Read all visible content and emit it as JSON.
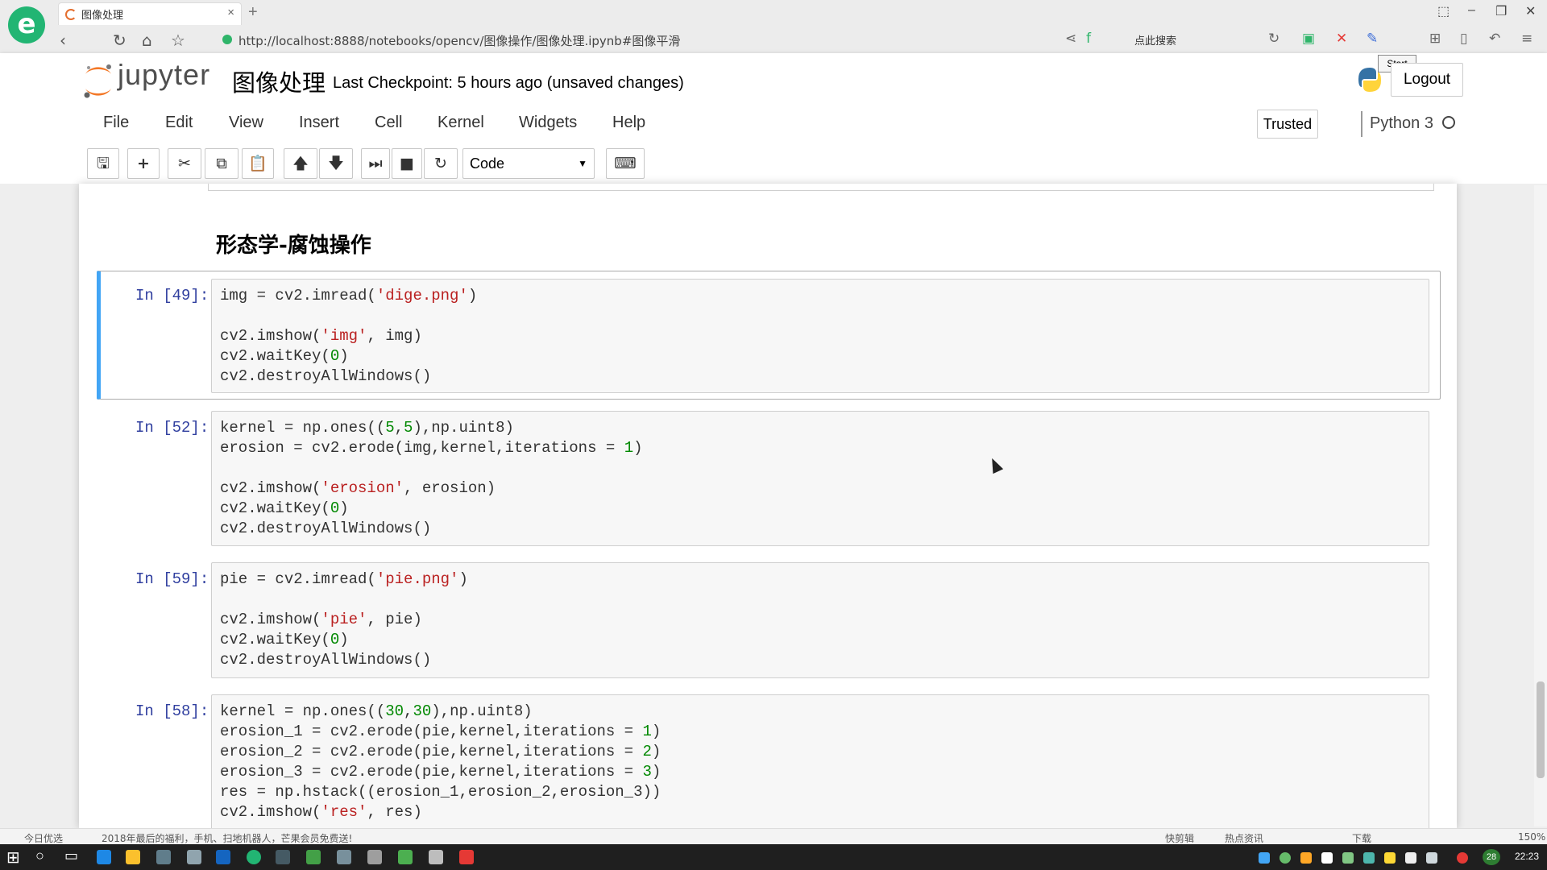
{
  "browser": {
    "tab_title": "图像处理",
    "new_tab": "+",
    "address": "http://localhost:8888/notebooks/opencv/图像操作/图像处理.ipynb#图像平滑",
    "search_placeholder": "点此搜索",
    "tooltip": "Start",
    "win_min": "–",
    "win_max": "❐",
    "win_close": "✕"
  },
  "notebook": {
    "logo_text": "jupyter",
    "name": "图像处理",
    "checkpoint": "Last Checkpoint: 5 hours ago (unsaved changes)",
    "logout_label": "Logout",
    "trusted_label": "Trusted",
    "kernel_name": "Python 3"
  },
  "menu": {
    "items": [
      "File",
      "Edit",
      "View",
      "Insert",
      "Cell",
      "Kernel",
      "Widgets",
      "Help"
    ]
  },
  "toolbar": {
    "cell_type": "Code"
  },
  "cells": {
    "heading": "形态学-腐蚀操作",
    "prompts": [
      "In [49]:",
      "In [52]:",
      "In [59]:",
      "In [58]:"
    ]
  },
  "statusbar": {
    "left_label": "今日优选",
    "news": "2018年最后的福利，手机、扫地机器人，芒果会员免费送!",
    "items": [
      "快剪辑",
      "热点资讯",
      "下载"
    ],
    "zoom": "150%"
  },
  "taskbar": {
    "time": "22:23",
    "badge": "28"
  },
  "colors": {
    "selected_cell_border": "#42a5f5",
    "prompt": "#303f9f",
    "string": "#ba2121",
    "number": "#008800"
  }
}
